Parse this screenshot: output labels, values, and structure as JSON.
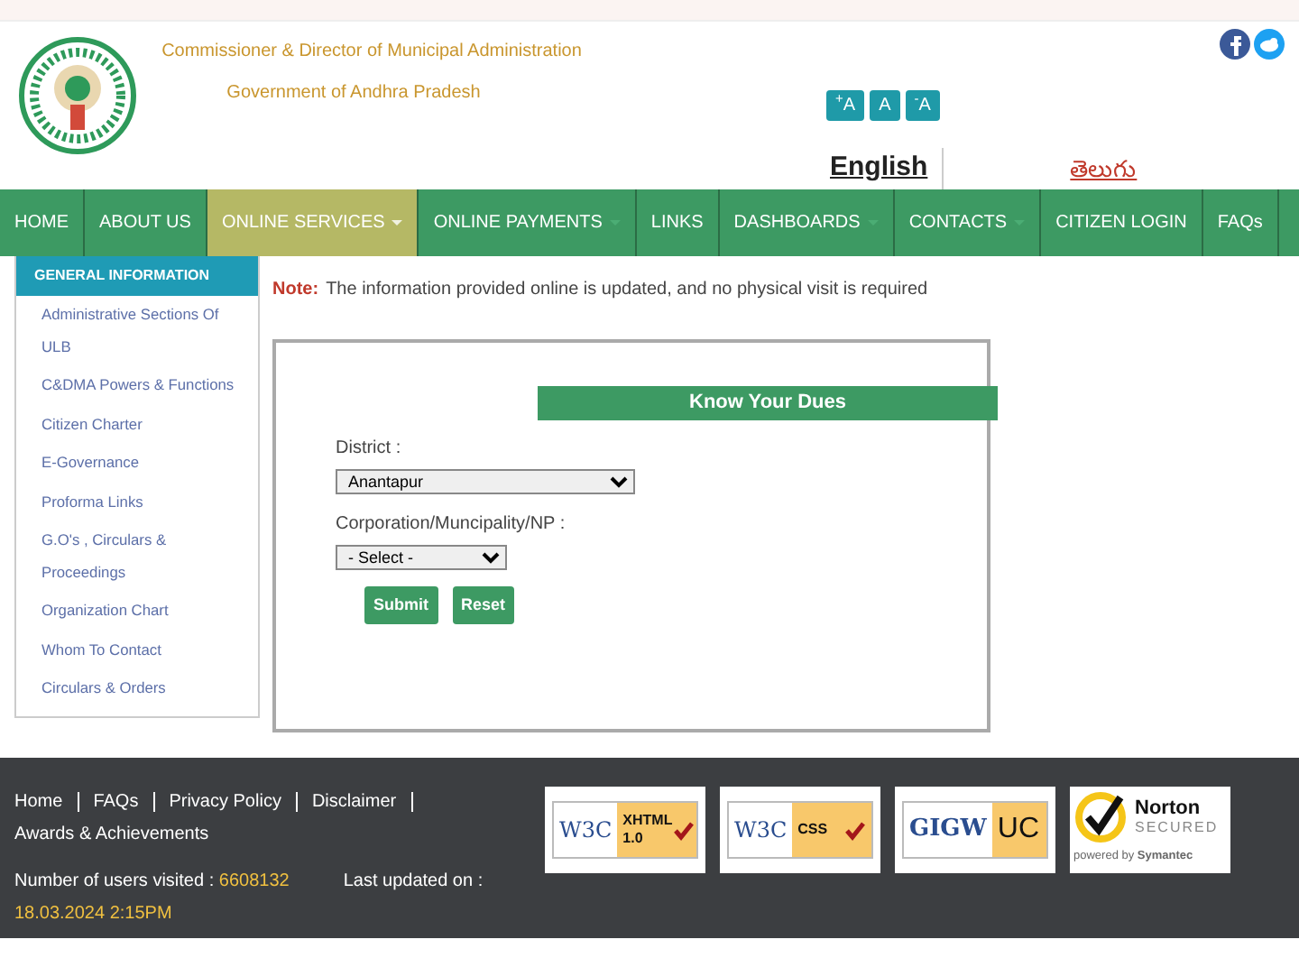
{
  "header": {
    "title": "Commissioner & Director of Municipal Administration",
    "subtitle": "Government of Andhra Pradesh",
    "font_buttons": [
      "$^{+}$A",
      "A",
      "$^{-}$A"
    ],
    "languages": [
      {
        "label": "English",
        "selected": true
      },
      {
        "label": "తెలుగు",
        "selected": false
      }
    ]
  },
  "nav": [
    {
      "label": "HOME",
      "selected": false,
      "caret": false
    },
    {
      "label": "ABOUT US",
      "selected": false,
      "caret": false
    },
    {
      "label": "ONLINE SERVICES",
      "selected": true,
      "caret": true
    },
    {
      "label": "ONLINE PAYMENTS",
      "selected": false,
      "caret": true
    },
    {
      "label": "LINKS",
      "selected": false,
      "caret": false
    },
    {
      "label": "DASHBOARDS",
      "selected": false,
      "caret": true
    },
    {
      "label": "CONTACTS",
      "selected": false,
      "caret": true
    },
    {
      "label": "CITIZEN LOGIN",
      "selected": false,
      "caret": false
    },
    {
      "label": "FAQs",
      "selected": false,
      "caret": false
    }
  ],
  "dropdown": {
    "heading": "GENERAL INFORMATION",
    "items": [
      "Administrative Sections Of ULB",
      "C&DMA Powers & Functions",
      "Citizen Charter",
      "E-Governance",
      "Proforma Links",
      "G.O's , Circulars & Proceedings",
      "Organization Chart",
      "Whom To Contact",
      "Circulars & Orders"
    ]
  },
  "note": {
    "label": "Note:",
    "text": "The information provided online is updated, and no physical visit is required"
  },
  "form": {
    "title": "Know Your Dues",
    "fields": [
      {
        "label": "District :",
        "value": "Anantapur"
      },
      {
        "label": "Corporation/Muncipality/NP :",
        "value": "- Select -"
      }
    ],
    "buttons": [
      "Submit",
      "Reset"
    ]
  },
  "footer": {
    "links": [
      "Home",
      "FAQs",
      "Privacy Policy",
      "Disclaimer",
      "Awards & Achievements"
    ],
    "visitors": {
      "label": "Number of users visited :",
      "value": "6608132"
    },
    "updated": {
      "label": "Last updated on :",
      "value": "18.03.2024 2:15PM"
    },
    "badges": [
      {
        "kind": "w3c",
        "logo": "W3C",
        "label": "XHTML 1.0"
      },
      {
        "kind": "w3c",
        "logo": "W3C",
        "label": "CSS"
      },
      {
        "kind": "gigw",
        "logo": "GIGW",
        "label": "UC"
      },
      {
        "kind": "norton",
        "logo": "Norton",
        "label": "SECURED",
        "footer": "powered by **Symantec**"
      }
    ]
  }
}
